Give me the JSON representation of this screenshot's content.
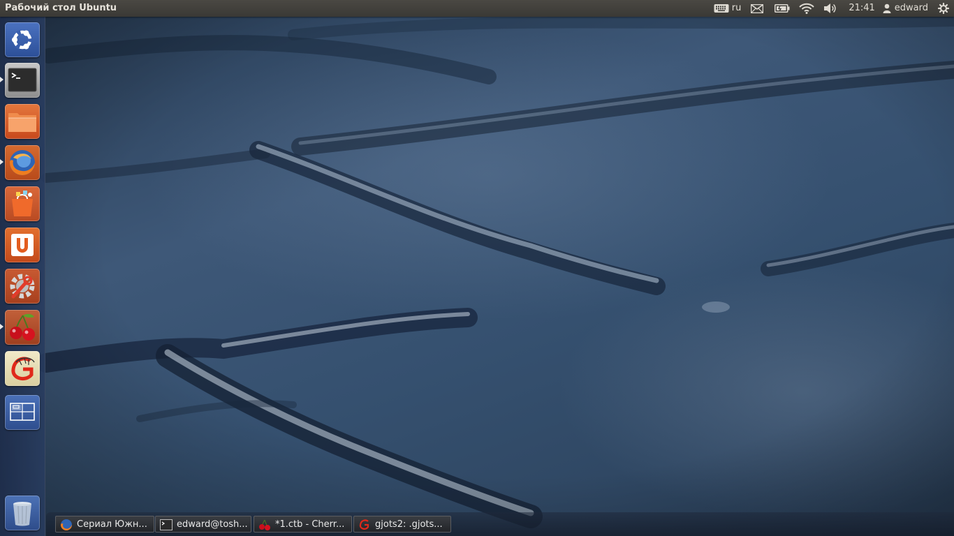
{
  "top_panel": {
    "window_title": "Рабочий стол Ubuntu",
    "keyboard_layout": "ru",
    "clock": "21:41",
    "user": "edward",
    "icons": [
      "keyboard-icon",
      "mail-icon",
      "battery-icon",
      "wifi-icon",
      "volume-icon",
      "user-icon",
      "gear-icon"
    ]
  },
  "launcher": {
    "items": [
      {
        "name": "dash-home",
        "icon": "ubuntu-logo-icon",
        "running": false
      },
      {
        "name": "terminal",
        "icon": "terminal-icon",
        "running": true
      },
      {
        "name": "files",
        "icon": "folder-icon",
        "running": false
      },
      {
        "name": "firefox",
        "icon": "firefox-icon",
        "running": true
      },
      {
        "name": "software-center",
        "icon": "shopping-bag-icon",
        "running": false
      },
      {
        "name": "ubuntu-one",
        "icon": "ubuntu-one-icon",
        "running": false
      },
      {
        "name": "system-settings",
        "icon": "settings-wrench-icon",
        "running": false
      },
      {
        "name": "cherrytree",
        "icon": "cherry-icon",
        "running": true
      },
      {
        "name": "gjots",
        "icon": "gjots-icon",
        "running": false
      },
      {
        "name": "workspace-switcher",
        "icon": "workspace-icon",
        "running": false
      },
      {
        "name": "trash",
        "icon": "trash-icon",
        "running": false
      }
    ]
  },
  "taskbar": {
    "tasks": [
      {
        "label": "Сериал Южн...",
        "icon": "firefox-icon"
      },
      {
        "label": "edward@tosh...",
        "icon": "terminal-icon"
      },
      {
        "label": "*1.ctb - Cherr...",
        "icon": "cherry-icon"
      },
      {
        "label": "gjots2: .gjots...",
        "icon": "gjots-icon"
      }
    ]
  },
  "colors": {
    "panel": "#3c3b37",
    "launcher": "#23355a",
    "ubuntu_orange": "#e95420"
  }
}
